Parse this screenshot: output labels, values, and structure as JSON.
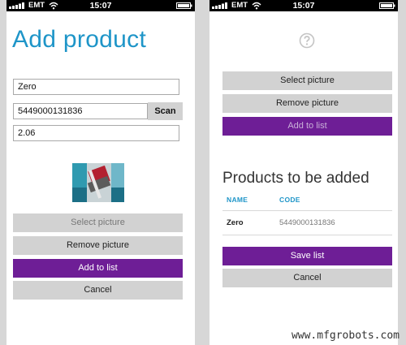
{
  "status_bar": {
    "carrier": "EMT",
    "time": "15:07"
  },
  "left": {
    "title": "Add product",
    "name_value": "Zero",
    "code_value": "5449000131836",
    "scan_label": "Scan",
    "price_value": "2.06",
    "select_picture": "Select picture",
    "remove_picture": "Remove picture",
    "add_to_list": "Add to list",
    "cancel": "Cancel"
  },
  "right": {
    "select_picture": "Select picture",
    "remove_picture": "Remove picture",
    "add_to_list": "Add to list",
    "products_title": "Products to be added",
    "columns": [
      "NAME",
      "CODE"
    ],
    "rows": [
      {
        "name": "Zero",
        "code": "5449000131836"
      }
    ],
    "save_list": "Save list",
    "cancel": "Cancel"
  },
  "icons": {
    "help": "question-circle-icon",
    "signal": "signal-bars-icon",
    "wifi": "wifi-icon",
    "battery": "battery-icon"
  },
  "colors": {
    "accent_blue": "#1e95c8",
    "purple": "#6e1e96",
    "button_grey": "#d2d2d2"
  },
  "watermark": "www.mfgrobots.com"
}
